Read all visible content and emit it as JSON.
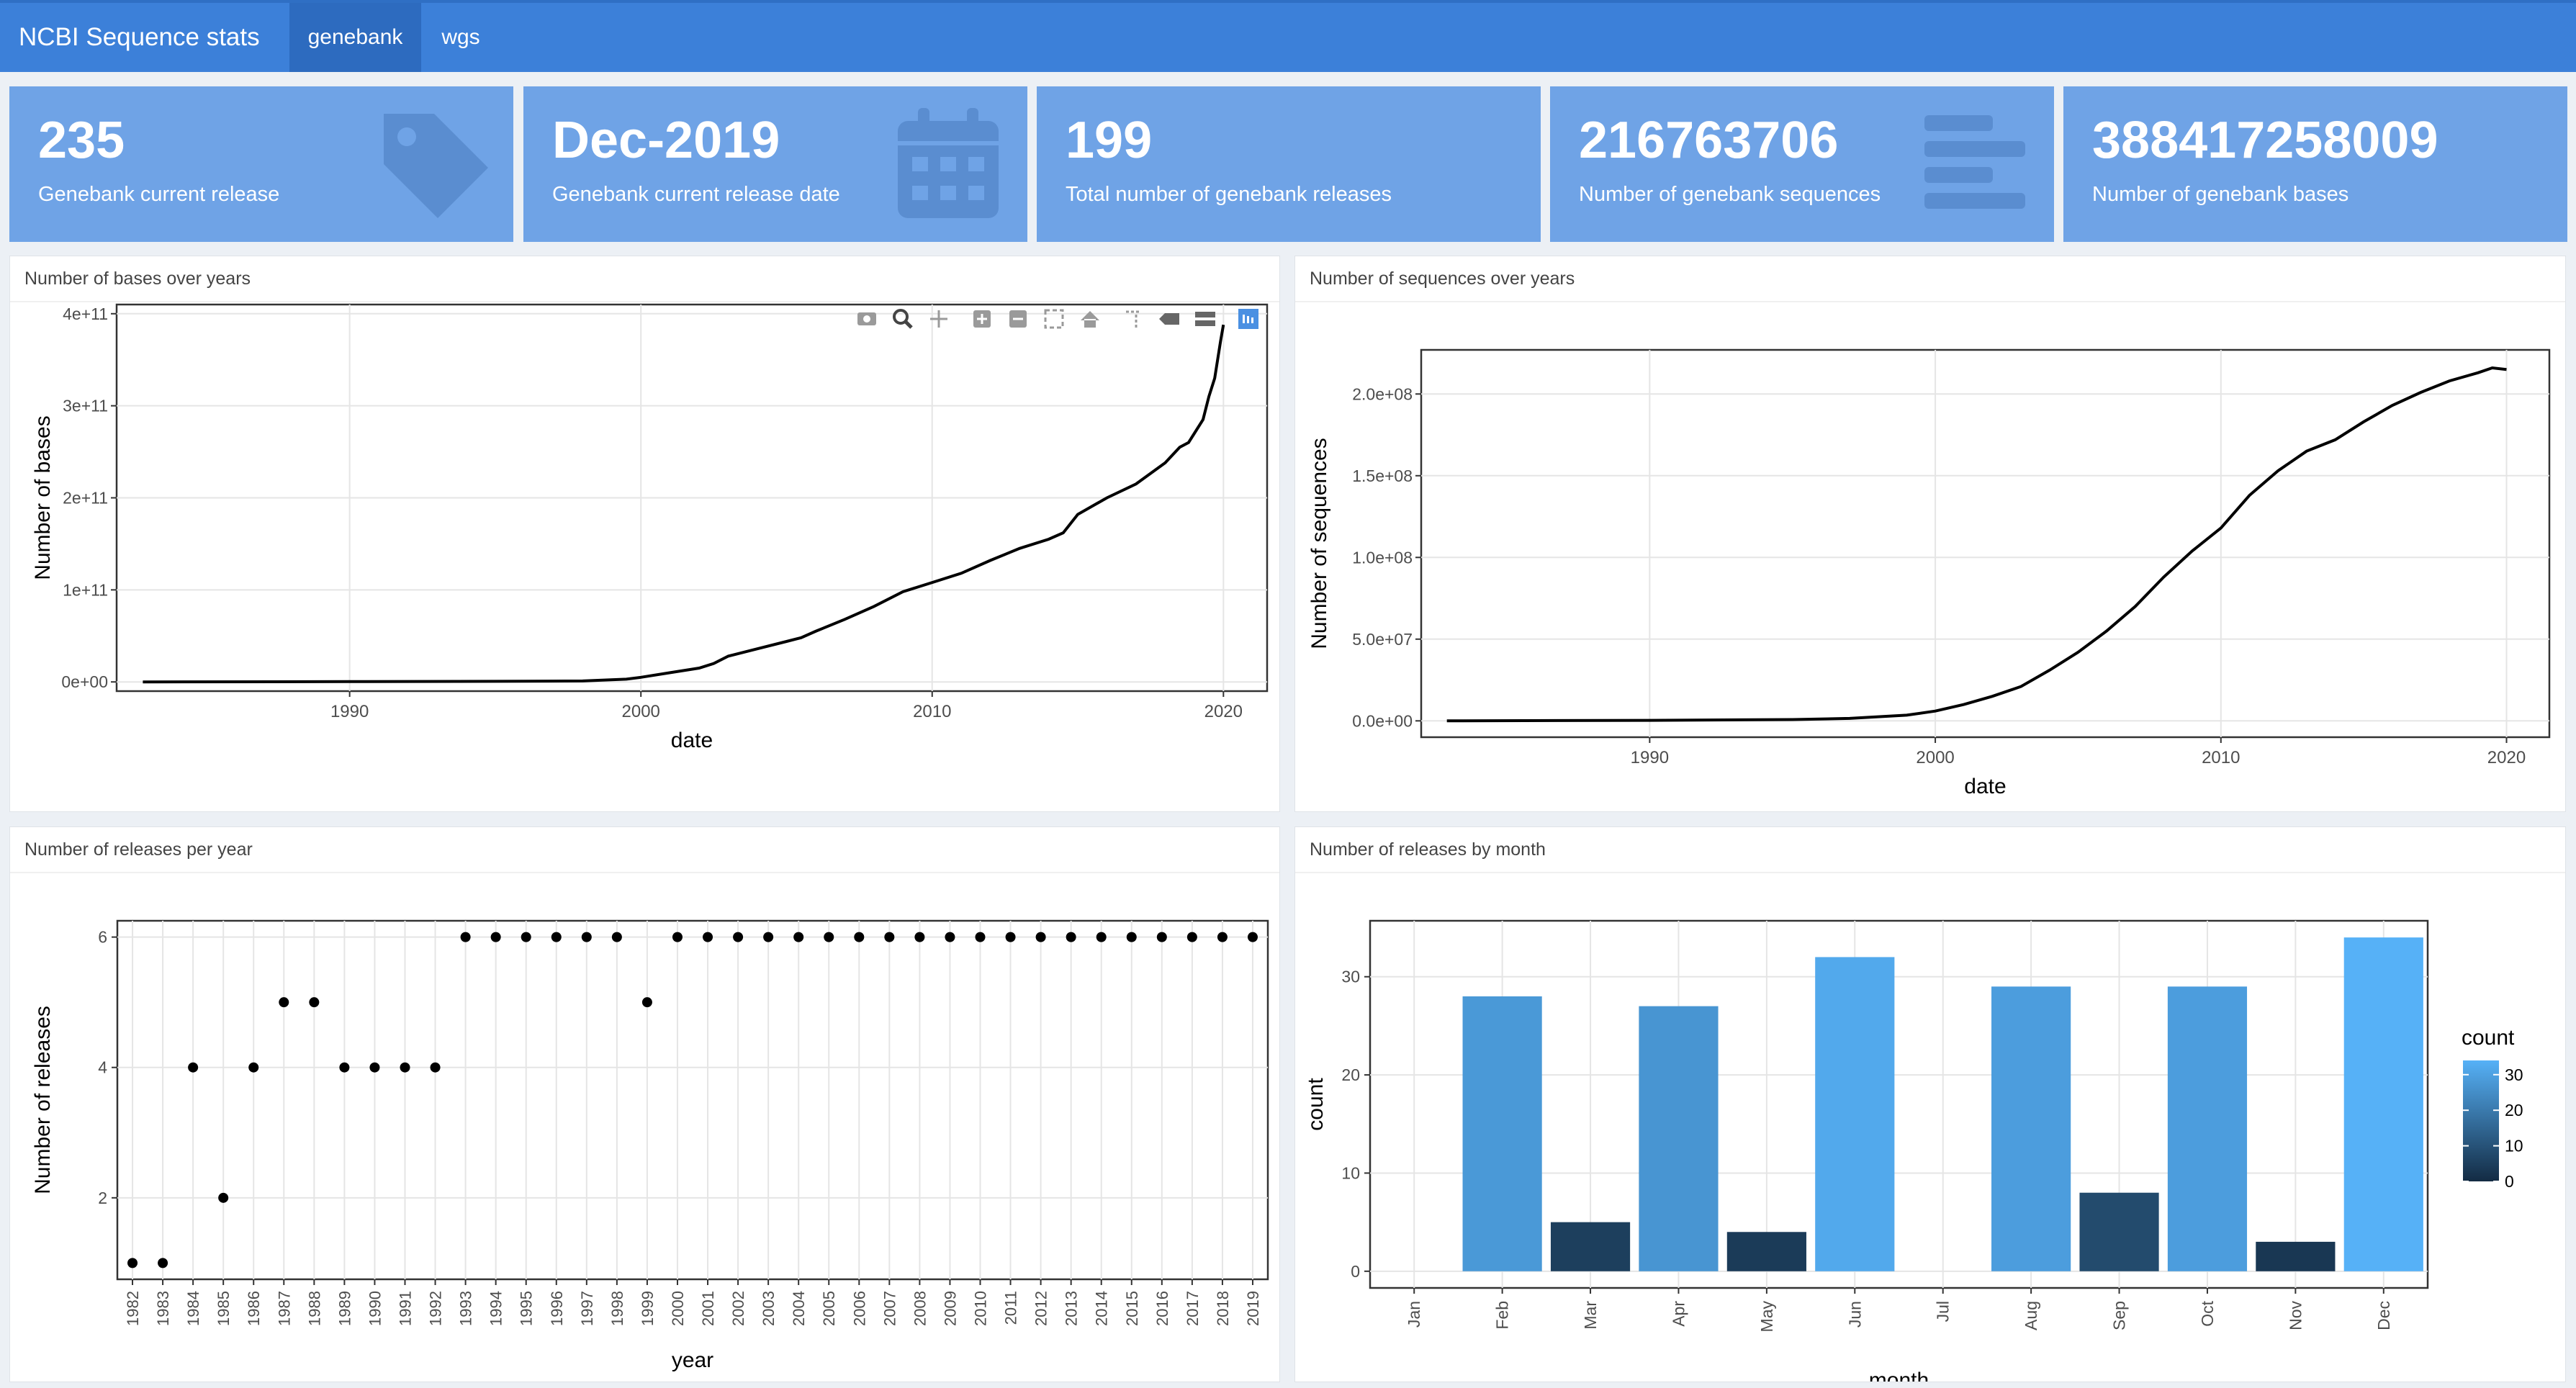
{
  "navbar": {
    "brand": "NCBI Sequence stats",
    "tabs": [
      {
        "label": "genebank",
        "active": true
      },
      {
        "label": "wgs",
        "active": false
      }
    ]
  },
  "value_boxes": [
    {
      "value": "235",
      "label": "Genebank current release",
      "icon": "tag-icon"
    },
    {
      "value": "Dec-2019",
      "label": "Genebank current release date",
      "icon": "calendar-icon"
    },
    {
      "value": "199",
      "label": "Total number of genebank releases",
      "icon": ""
    },
    {
      "value": "216763706",
      "label": "Number of genebank sequences",
      "icon": "list-icon"
    },
    {
      "value": "388417258009",
      "label": "Number of genebank bases",
      "icon": ""
    }
  ],
  "panels": {
    "bases": {
      "title": "Number of bases over years"
    },
    "sequences": {
      "title": "Number of sequences over years"
    },
    "releases_year": {
      "title": "Number of releases per year"
    },
    "releases_month": {
      "title": "Number of releases by month"
    }
  },
  "colors": {
    "navbar": "#3c80d9",
    "value_box": "#6fa3e6",
    "gradient_low": "#132b43",
    "gradient_high": "#56b1f7"
  },
  "plotly_toolbar": [
    "camera-icon",
    "zoom-icon",
    "pan-icon",
    "zoom-in-icon",
    "zoom-out-icon",
    "autoscale-icon",
    "reset-axes-icon",
    "spike-lines-icon",
    "hover-closest-icon",
    "hover-compare-icon",
    "plotly-logo-icon"
  ],
  "chart_data": [
    {
      "type": "line",
      "xlabel": "date",
      "ylabel": "Number of bases",
      "xlim": [
        1982,
        2021.5
      ],
      "ylim": [
        -10000000000.0,
        410000000000.0
      ],
      "xticks": [
        1990,
        2000,
        2010,
        2020
      ],
      "yticks": [
        0,
        100000000000.0,
        200000000000.0,
        300000000000.0,
        400000000000.0
      ],
      "yticklabels": [
        "0e+00",
        "1e+11",
        "2e+11",
        "3e+11",
        "4e+11"
      ],
      "grid": true,
      "x": [
        1982.9,
        1990,
        1995,
        1998,
        1999.5,
        2000,
        2001,
        2002,
        2002.5,
        2003,
        2004,
        2005,
        2005.5,
        2006,
        2007,
        2008,
        2009,
        2010,
        2011,
        2012,
        2013,
        2014,
        2014.5,
        2015,
        2016,
        2017,
        2018,
        2018.5,
        2018.8,
        2019,
        2019.3,
        2019.5,
        2019.7,
        2019.9,
        2020
      ],
      "y": [
        0,
        300000000.0,
        600000000.0,
        1000000000.0,
        3000000000.0,
        5000000000.0,
        10000000000.0,
        15000000000.0,
        20000000000.0,
        28000000000.0,
        36000000000.0,
        44000000000.0,
        48000000000.0,
        55000000000.0,
        68000000000.0,
        82000000000.0,
        98000000000.0,
        108000000000.0,
        118000000000.0,
        132000000000.0,
        145000000000.0,
        155000000000.0,
        162000000000.0,
        182000000000.0,
        200000000000.0,
        215000000000.0,
        238000000000.0,
        255000000000.0,
        260000000000.0,
        270000000000.0,
        285000000000.0,
        310000000000.0,
        330000000000.0,
        370000000000.0,
        388000000000.0
      ]
    },
    {
      "type": "line",
      "xlabel": "date",
      "ylabel": "Number of sequences",
      "xlim": [
        1982,
        2021.5
      ],
      "ylim": [
        -10000000.0,
        227000000.0
      ],
      "xticks": [
        1990,
        2000,
        2010,
        2020
      ],
      "yticks": [
        0,
        50000000.0,
        100000000.0,
        150000000.0,
        200000000.0
      ],
      "yticklabels": [
        "0.0e+00",
        "5.0e+07",
        "1.0e+08",
        "1.5e+08",
        "2.0e+08"
      ],
      "grid": true,
      "x": [
        1982.9,
        1990,
        1995,
        1997,
        1998,
        1999,
        2000,
        2001,
        2002,
        2003,
        2004,
        2005,
        2006,
        2007,
        2008,
        2009,
        2010,
        2011,
        2012,
        2013,
        2014,
        2015,
        2016,
        2017,
        2018,
        2019,
        2019.5,
        2020
      ],
      "y": [
        0,
        300000,
        800000,
        1500000,
        2500000,
        3500000,
        6000000,
        10000000,
        15000000,
        21000000,
        31000000,
        42000000,
        55000000,
        70000000,
        88000000,
        104000000,
        118000000,
        138000000,
        153000000,
        165000000,
        172000000,
        183000000,
        193000000,
        201000000,
        208000000,
        213000000,
        216000000,
        215000000
      ]
    },
    {
      "type": "scatter",
      "xlabel": "year",
      "ylabel": "Number of releases",
      "ylim": [
        0.75,
        6.25
      ],
      "yticks": [
        2,
        4,
        6
      ],
      "grid": true,
      "categories": [
        "1982",
        "1983",
        "1984",
        "1985",
        "1986",
        "1987",
        "1988",
        "1989",
        "1990",
        "1991",
        "1992",
        "1993",
        "1994",
        "1995",
        "1996",
        "1997",
        "1998",
        "1999",
        "2000",
        "2001",
        "2002",
        "2003",
        "2004",
        "2005",
        "2006",
        "2007",
        "2008",
        "2009",
        "2010",
        "2011",
        "2012",
        "2013",
        "2014",
        "2015",
        "2016",
        "2017",
        "2018",
        "2019"
      ],
      "values": [
        1,
        1,
        4,
        2,
        4,
        5,
        5,
        4,
        4,
        4,
        4,
        6,
        6,
        6,
        6,
        6,
        6,
        5,
        6,
        6,
        6,
        6,
        6,
        6,
        6,
        6,
        6,
        6,
        6,
        6,
        6,
        6,
        6,
        6,
        6,
        6,
        6,
        6
      ]
    },
    {
      "type": "bar",
      "xlabel": "month",
      "ylabel": "count",
      "ylim": [
        -1.7,
        35.7
      ],
      "yticks": [
        0,
        10,
        20,
        30
      ],
      "grid": true,
      "categories": [
        "Jan",
        "Feb",
        "Mar",
        "Apr",
        "May",
        "Jun",
        "Jul",
        "Aug",
        "Sep",
        "Oct",
        "Nov",
        "Dec"
      ],
      "values": [
        0,
        28,
        5,
        27,
        4,
        32,
        0,
        29,
        8,
        29,
        3,
        34
      ],
      "legend": {
        "title": "count",
        "ticks": [
          0,
          10,
          20,
          30
        ],
        "position": "right"
      }
    }
  ]
}
